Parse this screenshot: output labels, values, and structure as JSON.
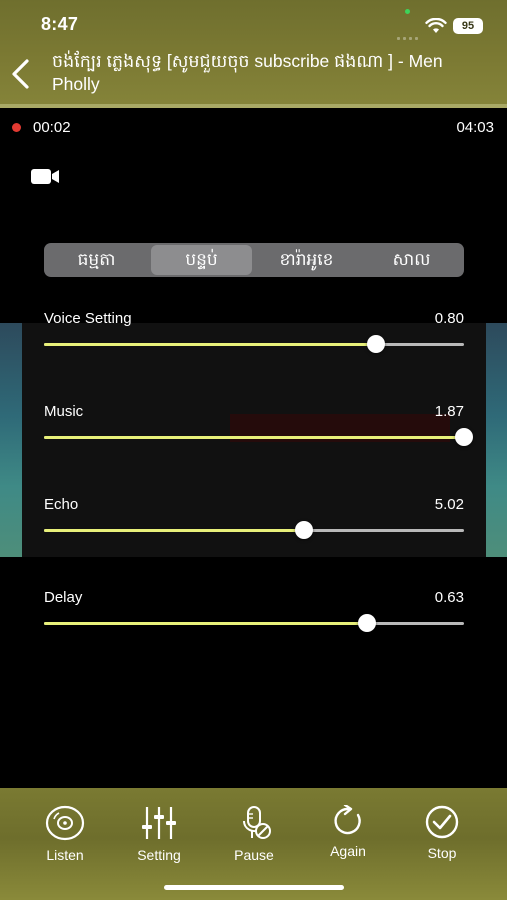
{
  "status_bar": {
    "time": "8:47",
    "battery": "95"
  },
  "header": {
    "title": "ចង់ក្បែរ ភ្លេងសុទ្ធ [សូមជួយចុច subscribe ផងណា ] - Men Pholly",
    "back_icon": "chevron-left-icon"
  },
  "player": {
    "recording": true,
    "elapsed": "00:02",
    "duration": "04:03",
    "camera_icon": "video-camera-icon"
  },
  "effect_tabs": {
    "selected": 1,
    "items": [
      {
        "label": "ធម្មតា"
      },
      {
        "label": "បន្ទប់"
      },
      {
        "label": "ខារ៉ាអូខេ"
      },
      {
        "label": "សាល"
      }
    ]
  },
  "sliders": [
    {
      "label": "Voice Setting",
      "value": "0.80",
      "position": 0.79
    },
    {
      "label": "Music",
      "value": "1.87",
      "position": 1.0
    },
    {
      "label": "Echo",
      "value": "5.02",
      "position": 0.62
    },
    {
      "label": "Delay",
      "value": "0.63",
      "position": 0.77
    }
  ],
  "toolbar": {
    "items": [
      {
        "label": "Listen",
        "icon": "disc-icon"
      },
      {
        "label": "Setting",
        "icon": "equalizer-icon"
      },
      {
        "label": "Pause",
        "icon": "mic-off-icon"
      },
      {
        "label": "Again",
        "icon": "refresh-icon"
      },
      {
        "label": "Stop",
        "icon": "check-circle-icon"
      }
    ]
  },
  "colors": {
    "accent": "#e8f07a",
    "header_bg": "#7c7a33",
    "record_dot": "#e23a32"
  }
}
